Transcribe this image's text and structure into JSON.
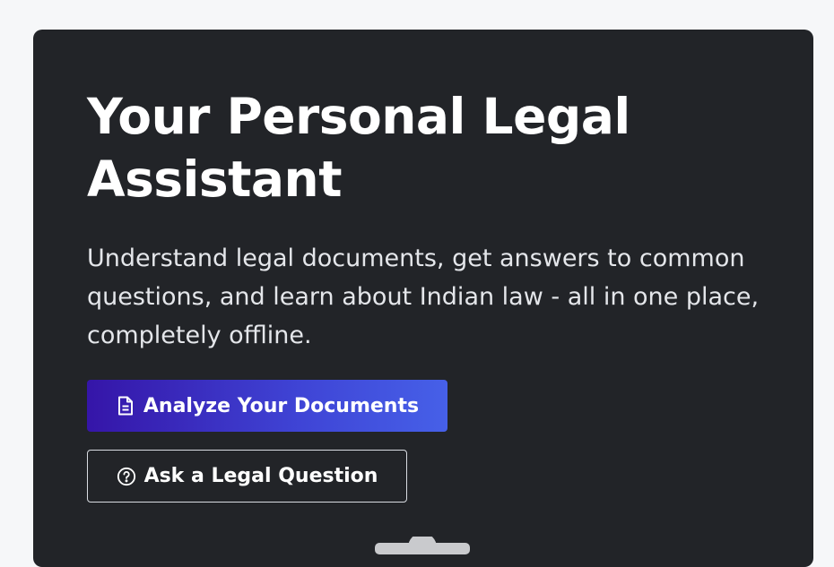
{
  "hero": {
    "title": "Your Personal Legal Assistant",
    "subtitle": "Understand legal documents, get answers to common questions, and learn about Indian law - all in one place, completely offline.",
    "primary_button": {
      "label": "Analyze Your Documents",
      "icon": "document-icon",
      "gradient_start": "#3515a8",
      "gradient_end": "#4660e8"
    },
    "secondary_button": {
      "label": "Ask a Legal Question",
      "icon": "question-circle-icon"
    }
  },
  "colors": {
    "page_background": "#f6f7f9",
    "card_background": "#222428",
    "text": "#ffffff"
  }
}
